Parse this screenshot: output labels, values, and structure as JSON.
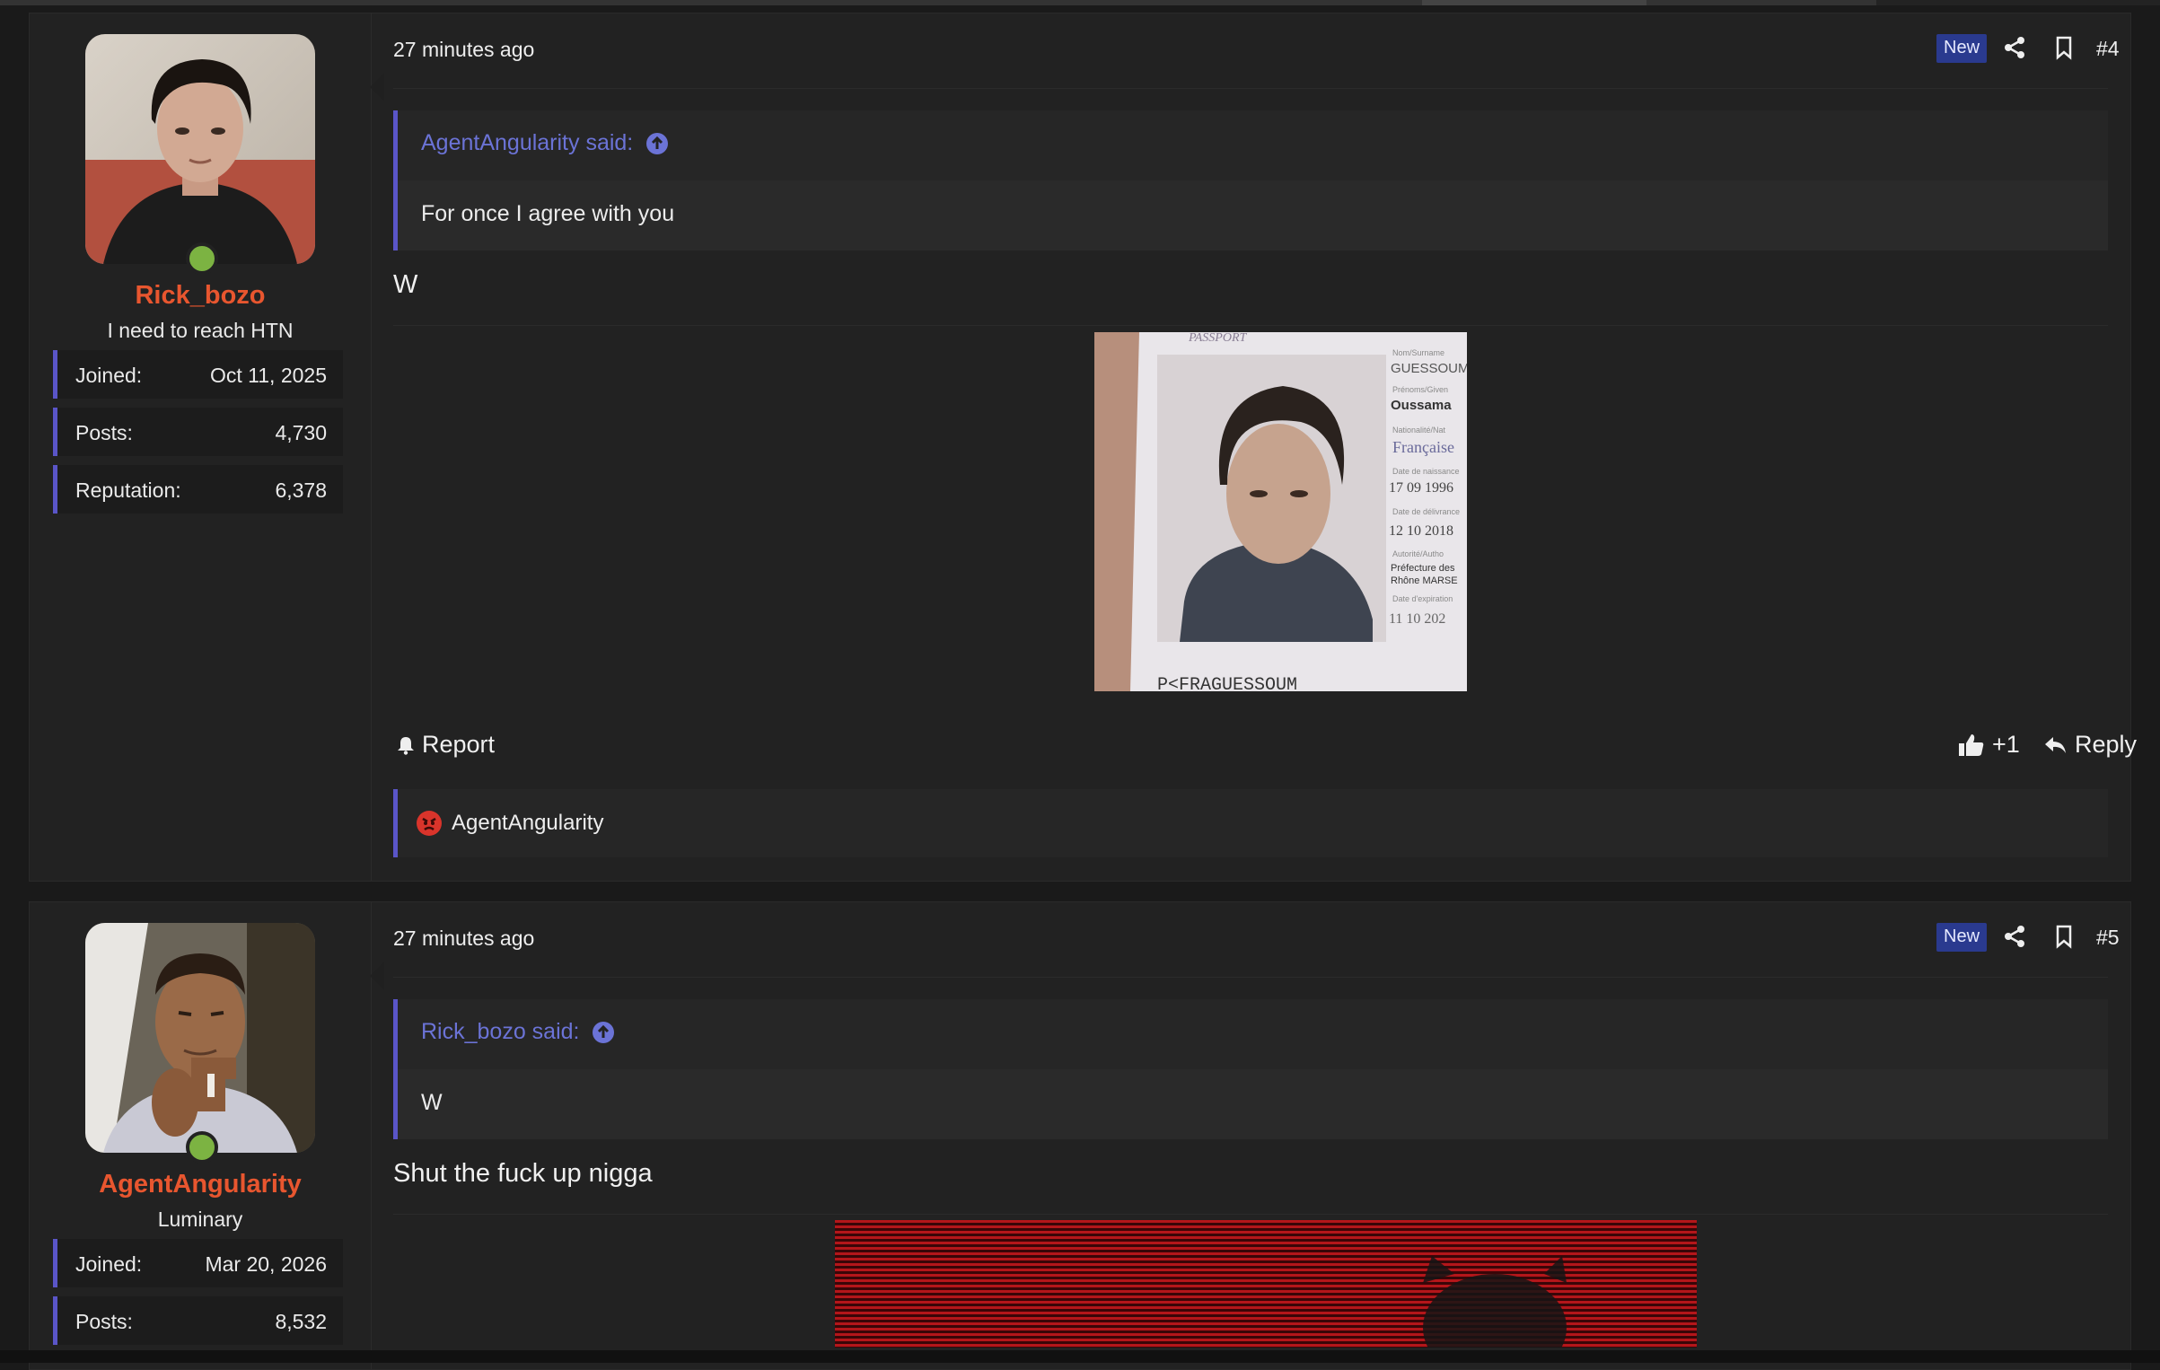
{
  "posts": [
    {
      "time": "27 minutes ago",
      "badge": "New",
      "post_number": "#4",
      "user": {
        "name": "Rick_bozo",
        "title": "I need to reach HTN",
        "stats": [
          {
            "label": "Joined:",
            "value": "Oct 11, 2025"
          },
          {
            "label": "Posts:",
            "value": "4,730"
          },
          {
            "label": "Reputation:",
            "value": "6,378"
          }
        ]
      },
      "quote": {
        "author_line": "AgentAngularity said:",
        "text": "For once I agree with you"
      },
      "message": "W",
      "attachment": {
        "passport_lines": [
          "PASSPORT",
          "Nom/Surname",
          "GUESSOUM",
          "Prénoms/Given",
          "Oussama",
          "Nationalité/Nat",
          "Française",
          "Date de naissance",
          "17 09 1996",
          "Date de délivrance",
          "12 10 2018",
          "Autorité/Autho",
          "Préfecture des",
          "Rhône MARSE",
          "Date d'expiration",
          "11 10 202",
          "P<FRAGUESSOUM"
        ]
      },
      "footer": {
        "report": "Report",
        "like_count": "+1",
        "reply": "Reply"
      },
      "reactions": {
        "user": "AgentAngularity"
      }
    },
    {
      "time": "27 minutes ago",
      "badge": "New",
      "post_number": "#5",
      "user": {
        "name": "AgentAngularity",
        "title": "Luminary",
        "stats": [
          {
            "label": "Joined:",
            "value": "Mar 20, 2026"
          },
          {
            "label": "Posts:",
            "value": "8,532"
          }
        ]
      },
      "quote": {
        "author_line": "Rick_bozo said:",
        "text": "W"
      },
      "message": "Shut the fuck up nigga"
    }
  ],
  "colors": {
    "accent": "#5a55c8",
    "username": "#e8562f",
    "quote_link": "#6b73d6",
    "badge_bg": "#2a3a8f",
    "online": "#7cb342"
  },
  "icons": [
    "share-icon",
    "bookmark-icon",
    "up-arrow-icon",
    "bell-icon",
    "thumbs-up-icon",
    "reply-icon",
    "angry-face-icon"
  ]
}
